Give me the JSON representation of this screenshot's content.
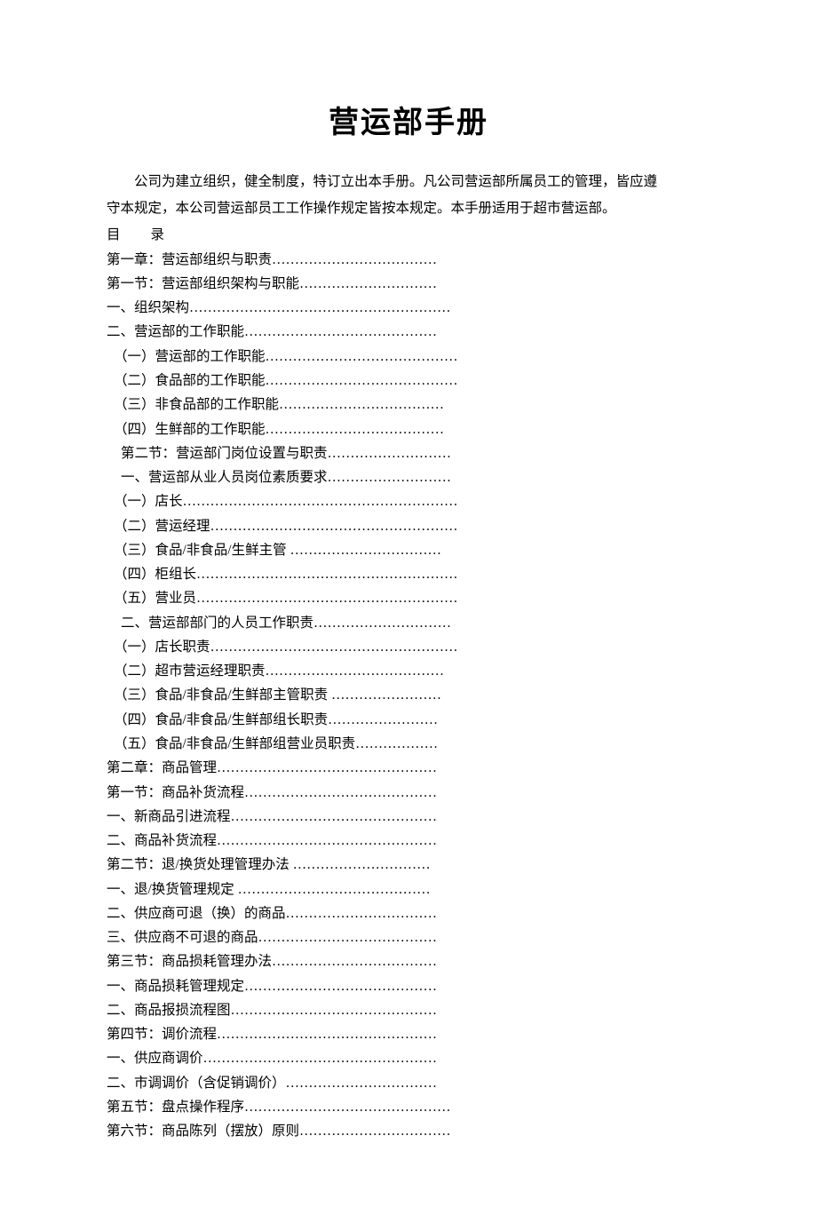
{
  "title": "营运部手册",
  "intro_line1": "公司为建立组织，健全制度，特订立出本手册。凡公司营运部所属员工的管理，皆应遵",
  "intro_line2": "守本规定，本公司营运部员工工作操作规定皆按本规定。本手册适用于超市营运部。",
  "toc_header": "目　　录",
  "toc": [
    {
      "indent": 0,
      "text": "第一章：营运部组织与职责………………………………"
    },
    {
      "indent": 0,
      "text": "第一节：营运部组织架构与职能…………………………"
    },
    {
      "indent": 0,
      "text": "一、组织架构…………………………………………………"
    },
    {
      "indent": 0,
      "text": "二、营运部的工作职能……………………………………"
    },
    {
      "indent": 1,
      "text": "（一）营运部的工作职能……………………………………"
    },
    {
      "indent": 1,
      "text": "（二）食品部的工作职能……………………………………"
    },
    {
      "indent": 1,
      "text": "（三）非食品部的工作职能………………………………"
    },
    {
      "indent": 1,
      "text": "（四）生鲜部的工作职能…………………………………"
    },
    {
      "indent": 2,
      "text": "第二节：营运部门岗位设置与职责………………………"
    },
    {
      "indent": 2,
      "text": "一、营运部从业人员岗位素质要求………………………"
    },
    {
      "indent": 1,
      "text": "（一）店长……………………………………………………"
    },
    {
      "indent": 1,
      "text": "（二）营运经理………………………………………………"
    },
    {
      "indent": 1,
      "text": "（三）食品/非食品/生鲜主管 ……………………………"
    },
    {
      "indent": 1,
      "text": "（四）柜组长…………………………………………………"
    },
    {
      "indent": 1,
      "text": "（五）营业员…………………………………………………"
    },
    {
      "indent": 2,
      "text": "二、营运部部门的人员工作职责…………………………"
    },
    {
      "indent": 1,
      "text": "（一）店长职责………………………………………………"
    },
    {
      "indent": 1,
      "text": "（二）超市营运经理职责…………………………………"
    },
    {
      "indent": 1,
      "text": "（三）食品/非食品/生鲜部主管职责 ……………………"
    },
    {
      "indent": 1,
      "text": "（四）食品/非食品/生鲜部组长职责……………………"
    },
    {
      "indent": 1,
      "text": "（五）食品/非食品/生鲜部组营业员职责………………"
    },
    {
      "indent": 0,
      "text": "第二章：商品管理…………………………………………"
    },
    {
      "indent": 0,
      "text": "第一节：商品补货流程……………………………………"
    },
    {
      "indent": 0,
      "text": "一、新商品引进流程………………………………………"
    },
    {
      "indent": 0,
      "text": "二、商品补货流程…………………………………………"
    },
    {
      "indent": 0,
      "text": "第二节：退/换货处理管理办法 …………………………"
    },
    {
      "indent": 0,
      "text": "一、退/换货管理规定 ……………………………………"
    },
    {
      "indent": 0,
      "text": "二、供应商可退（换）的商品……………………………"
    },
    {
      "indent": 0,
      "text": "三、供应商不可退的商品…………………………………"
    },
    {
      "indent": 0,
      "text": "第三节：商品损耗管理办法………………………………"
    },
    {
      "indent": 0,
      "text": "一、商品损耗管理规定……………………………………"
    },
    {
      "indent": 0,
      "text": "二、商品报损流程图………………………………………"
    },
    {
      "indent": 0,
      "text": "第四节：调价流程…………………………………………"
    },
    {
      "indent": 0,
      "text": "一、供应商调价……………………………………………"
    },
    {
      "indent": 0,
      "text": "二、市调调价（含促销调价）……………………………"
    },
    {
      "indent": 0,
      "text": "第五节：盘点操作程序………………………………………"
    },
    {
      "indent": 0,
      "text": "第六节：商品陈列（摆放）原则……………………………"
    }
  ]
}
